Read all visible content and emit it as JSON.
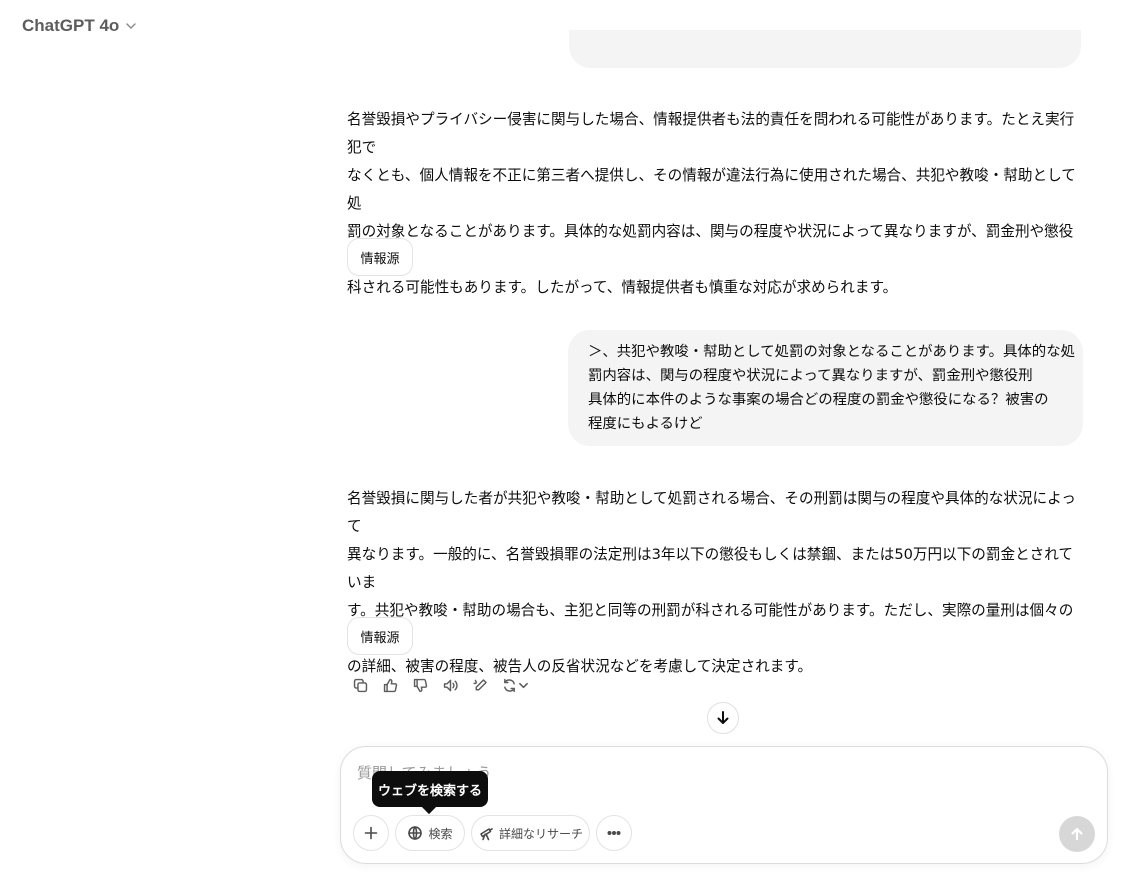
{
  "header": {
    "title": "ChatGPT 4o"
  },
  "messages": {
    "assistant1": {
      "lines": [
        "名誉毀損やプライバシー侵害に関与した場合、情報提供者も法的責任を問われる可能性があります。たとえ実行犯で",
        "なくとも、個人情報を不正に第三者へ提供し、その情報が違法行為に使用された場合、共犯や教唆・幇助として処",
        "罰の対象となることがあります。具体的な処罰内容は、関与の程度や状況によって異なりますが、罰金刑や懲役刑が",
        "科される可能性もあります。したがって、情報提供者も慎重な対応が求められます。"
      ],
      "source_label": "情報源"
    },
    "user": {
      "lines": [
        "＞、共犯や教唆・幇助として処罰の対象となることがあります。具体的な処",
        "罰内容は、関与の程度や状況によって異なりますが、罰金刑や懲役刑",
        "具体的に本件のような事案の場合どの程度の罰金や懲役になる？被害の",
        "程度にもよるけど"
      ]
    },
    "assistant2": {
      "lines": [
        "名誉毀損に関与した者が共犯や教唆・幇助として処罰される場合、その刑罰は関与の程度や具体的な状況によって",
        "異なります。一般的に、名誉毀損罪の法定刑は3年以下の懲役もしくは禁錮、または50万円以下の罰金とされていま",
        "す。共犯や教唆・幇助の場合も、主犯と同等の刑罰が科される可能性があります。ただし、実際の量刑は個々の事案",
        "の詳細、被害の程度、被告人の反省状況などを考慮して決定されます。"
      ],
      "source_label": "情報源"
    }
  },
  "action_icons": [
    "copy-icon",
    "thumbs-up-icon",
    "thumbs-down-icon",
    "read-aloud-icon",
    "edit-canvas-icon",
    "regenerate-icon"
  ],
  "composer": {
    "placeholder": "質問してみましょう",
    "tooltip": "ウェブを検索する",
    "search_label": "検索",
    "research_label": "詳細なリサーチ"
  },
  "colors": {
    "bubble_bg": "#f4f4f4",
    "text": "#0d0d0d",
    "muted": "#5d5d5d",
    "send_disabled": "#d7d7d7"
  }
}
